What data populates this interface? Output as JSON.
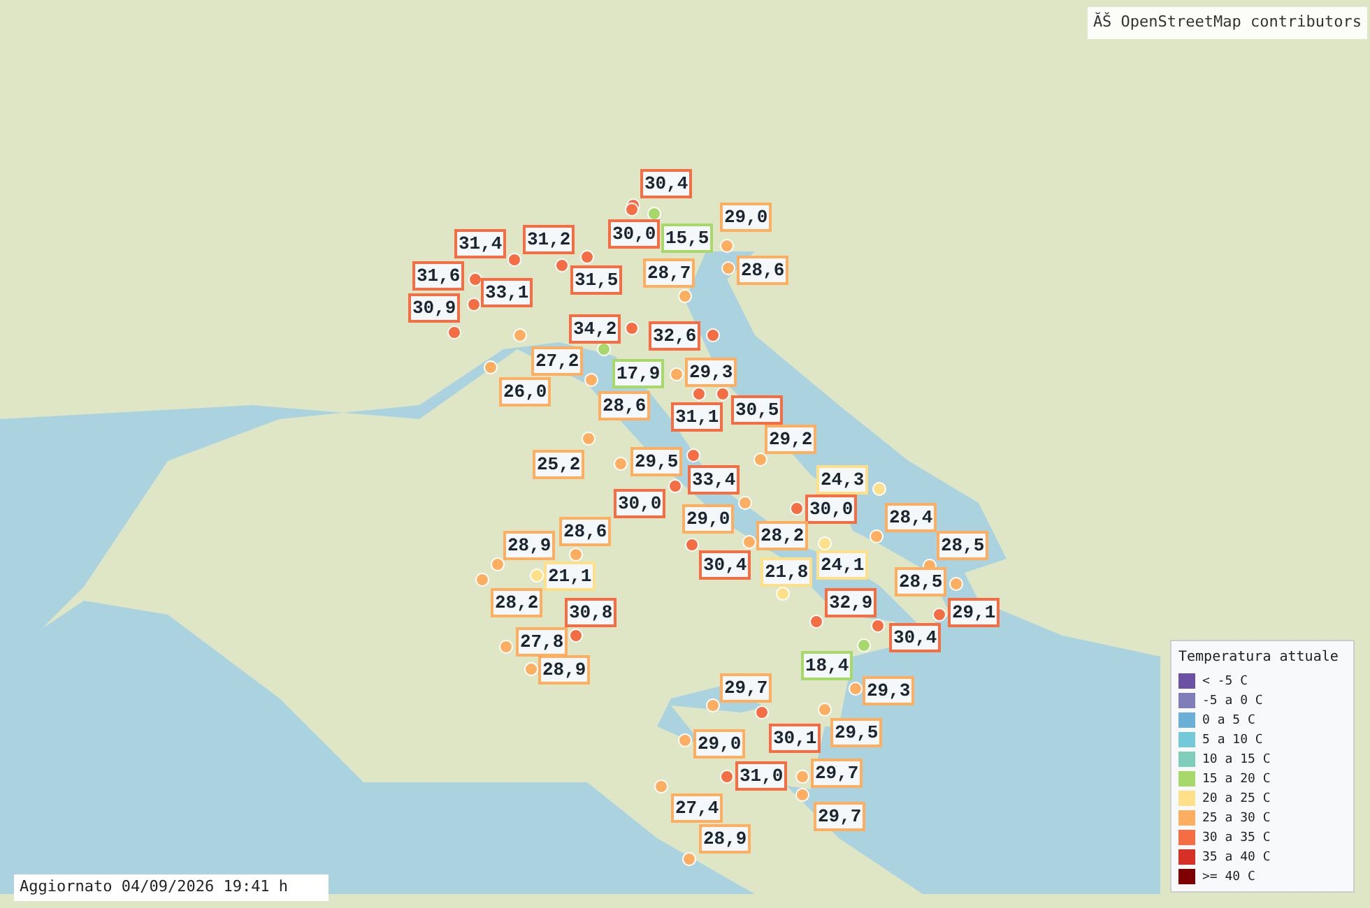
{
  "attribution": "ĂŠ OpenStreetMap contributors",
  "stations": [
    {
      "value": "30,4",
      "color": "#f46d43"
    },
    {
      "value": "29,0",
      "color": "#fdae61"
    },
    {
      "value": "31,4",
      "color": "#f46d43"
    },
    {
      "value": "31,2",
      "color": "#f46d43"
    },
    {
      "value": "30,0",
      "color": "#f46d43"
    },
    {
      "value": "15,5",
      "color": "#a6d96a"
    },
    {
      "value": "31,6",
      "color": "#f46d43"
    },
    {
      "value": "31,5",
      "color": "#f46d43"
    },
    {
      "value": "28,7",
      "color": "#fdae61"
    },
    {
      "value": "28,6",
      "color": "#fdae61"
    },
    {
      "value": "33,1",
      "color": "#f46d43"
    },
    {
      "value": "30,9",
      "color": "#f46d43"
    },
    {
      "value": "34,2",
      "color": "#f46d43"
    },
    {
      "value": "32,6",
      "color": "#f46d43"
    },
    {
      "value": "27,2",
      "color": "#fdae61"
    },
    {
      "value": "17,9",
      "color": "#a6d96a"
    },
    {
      "value": "29,3",
      "color": "#fdae61"
    },
    {
      "value": "26,0",
      "color": "#fdae61"
    },
    {
      "value": "28,6",
      "color": "#fdae61"
    },
    {
      "value": "31,1",
      "color": "#f46d43"
    },
    {
      "value": "30,5",
      "color": "#f46d43"
    },
    {
      "value": "29,2",
      "color": "#fdae61"
    },
    {
      "value": "25,2",
      "color": "#fdae61"
    },
    {
      "value": "29,5",
      "color": "#fdae61"
    },
    {
      "value": "33,4",
      "color": "#f46d43"
    },
    {
      "value": "24,3",
      "color": "#fee08b"
    },
    {
      "value": "30,0",
      "color": "#f46d43"
    },
    {
      "value": "29,0",
      "color": "#fdae61"
    },
    {
      "value": "30,0",
      "color": "#f46d43"
    },
    {
      "value": "28,4",
      "color": "#fdae61"
    },
    {
      "value": "28,9",
      "color": "#fdae61"
    },
    {
      "value": "28,6",
      "color": "#fdae61"
    },
    {
      "value": "28,2",
      "color": "#fdae61"
    },
    {
      "value": "28,5",
      "color": "#fdae61"
    },
    {
      "value": "21,1",
      "color": "#fee08b"
    },
    {
      "value": "30,4",
      "color": "#f46d43"
    },
    {
      "value": "21,8",
      "color": "#fee08b"
    },
    {
      "value": "24,1",
      "color": "#fee08b"
    },
    {
      "value": "28,5",
      "color": "#fdae61"
    },
    {
      "value": "28,2",
      "color": "#fdae61"
    },
    {
      "value": "30,8",
      "color": "#f46d43"
    },
    {
      "value": "32,9",
      "color": "#f46d43"
    },
    {
      "value": "29,1",
      "color": "#f46d43"
    },
    {
      "value": "27,8",
      "color": "#fdae61"
    },
    {
      "value": "30,4",
      "color": "#f46d43"
    },
    {
      "value": "28,9",
      "color": "#fdae61"
    },
    {
      "value": "18,4",
      "color": "#a6d96a"
    },
    {
      "value": "29,7",
      "color": "#fdae61"
    },
    {
      "value": "29,3",
      "color": "#fdae61"
    },
    {
      "value": "29,0",
      "color": "#fdae61"
    },
    {
      "value": "30,1",
      "color": "#f46d43"
    },
    {
      "value": "29,5",
      "color": "#fdae61"
    },
    {
      "value": "31,0",
      "color": "#f46d43"
    },
    {
      "value": "29,7",
      "color": "#fdae61"
    },
    {
      "value": "27,4",
      "color": "#fdae61"
    },
    {
      "value": "29,7",
      "color": "#fdae61"
    },
    {
      "value": "28,9",
      "color": "#fdae61"
    }
  ],
  "legend": {
    "title": "Temperatura attuale",
    "items": [
      {
        "label": "< -5 C",
        "color": "#6a51a3"
      },
      {
        "label": "-5 a 0 C",
        "color": "#807dba"
      },
      {
        "label": "0 a 5 C",
        "color": "#6baed6"
      },
      {
        "label": "5 a 10 C",
        "color": "#74c9d9"
      },
      {
        "label": "10 a 15 C",
        "color": "#7fcdbb"
      },
      {
        "label": "15 a 20 C",
        "color": "#a6d96a"
      },
      {
        "label": "20 a 25 C",
        "color": "#fee08b"
      },
      {
        "label": "25 a 30 C",
        "color": "#fdae61"
      },
      {
        "label": "30 a 35 C",
        "color": "#f46d43"
      },
      {
        "label": "35 a 40 C",
        "color": "#d73027"
      },
      {
        "label": ">= 40 C",
        "color": "#7f0000"
      }
    ]
  },
  "status": "Aggiornato 04/09/2026 19:41 h"
}
